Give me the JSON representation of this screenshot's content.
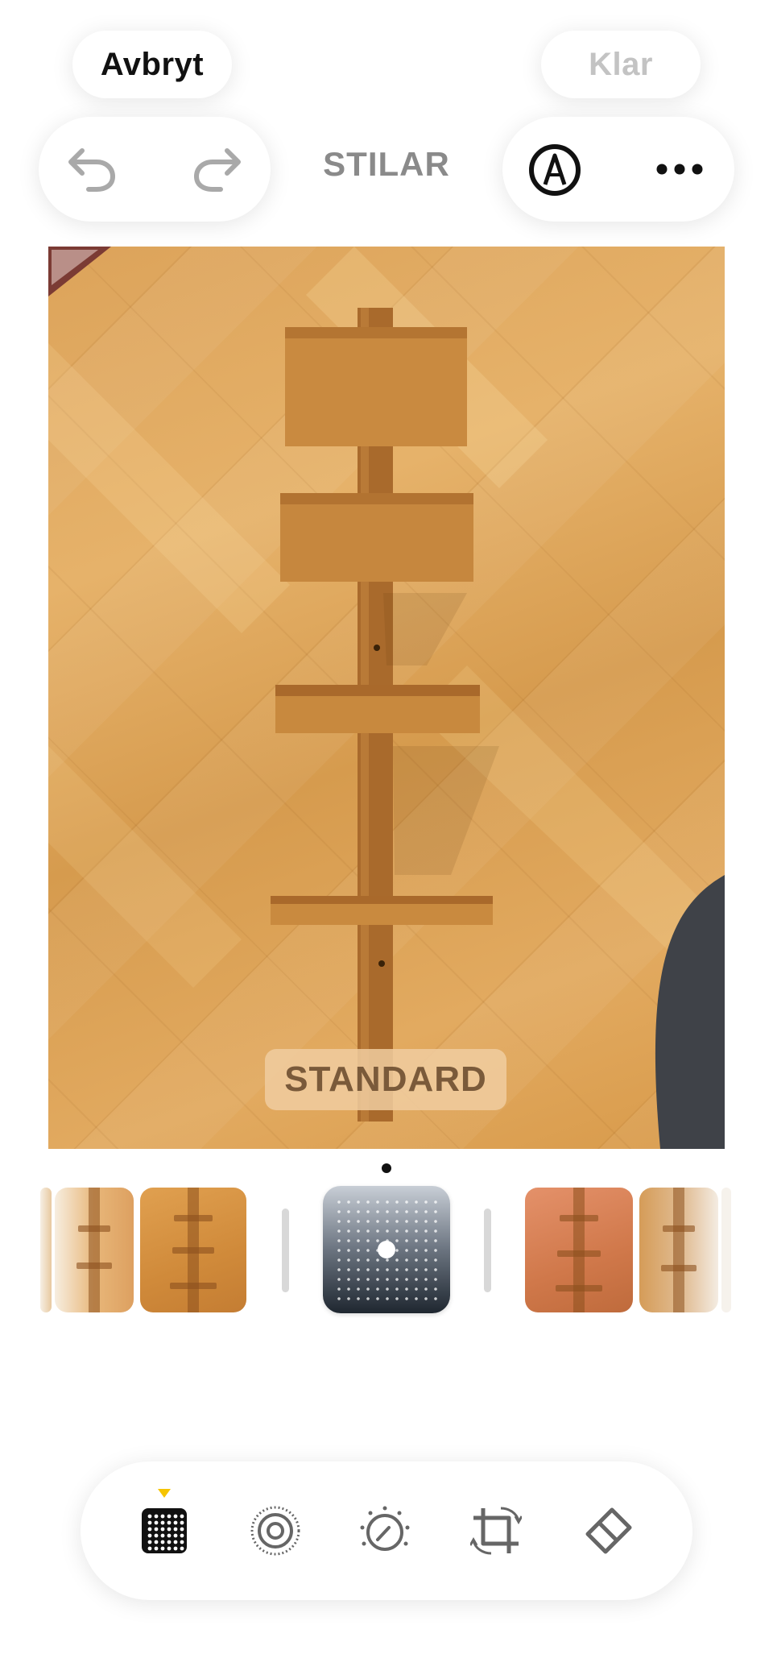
{
  "header": {
    "cancel_label": "Avbryt",
    "done_label": "Klar",
    "section_title": "STILAR"
  },
  "icons": {
    "undo": "undo-icon",
    "redo": "redo-icon",
    "markup": "markup-pen-icon",
    "more": "more-icon",
    "styles": "styles-grid-icon",
    "live": "live-photo-icon",
    "adjust": "adjust-dial-icon",
    "crop": "crop-rotate-icon",
    "cleanup": "eraser-icon"
  },
  "photo": {
    "style_label": "STANDARD"
  },
  "style_carousel": {
    "selected_index": 2
  },
  "colors": {
    "active_tool_marker": "#f5c400",
    "done_disabled": "#c3c3c3"
  }
}
